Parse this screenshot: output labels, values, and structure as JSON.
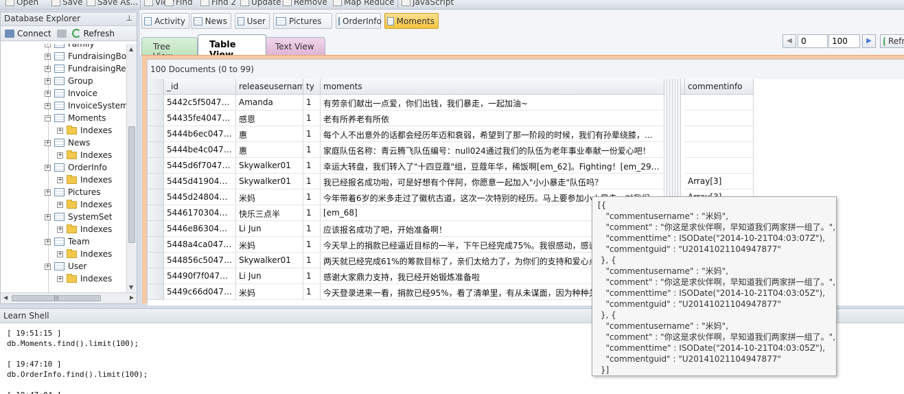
{
  "toolbar": {
    "items": [
      "Open",
      "Save",
      "Save As...",
      "View",
      "Find",
      "Find 2",
      "Update",
      "Remove",
      "Map Reduce",
      "JavaScript"
    ]
  },
  "explorer": {
    "title": "Database Explorer",
    "pin_glyph": "⊥",
    "connect_label": "Connect",
    "refresh_label": "Refresh",
    "tree": [
      {
        "label": "Family",
        "type": "collection"
      },
      {
        "label": "FundraisingBox",
        "type": "collection"
      },
      {
        "label": "FundraisingRec",
        "type": "collection"
      },
      {
        "label": "Group",
        "type": "collection"
      },
      {
        "label": "Invoice",
        "type": "collection"
      },
      {
        "label": "InvoiceSystemS",
        "type": "collection"
      },
      {
        "label": "Moments",
        "type": "collection"
      },
      {
        "label": "Indexes",
        "type": "indexes"
      },
      {
        "label": "News",
        "type": "collection"
      },
      {
        "label": "Indexes",
        "type": "indexes"
      },
      {
        "label": "OrderInfo",
        "type": "collection"
      },
      {
        "label": "Indexes",
        "type": "indexes"
      },
      {
        "label": "Pictures",
        "type": "collection"
      },
      {
        "label": "Indexes",
        "type": "indexes"
      },
      {
        "label": "SystemSet",
        "type": "collection"
      },
      {
        "label": "Indexes",
        "type": "indexes"
      },
      {
        "label": "Team",
        "type": "collection"
      },
      {
        "label": "Indexes",
        "type": "indexes"
      },
      {
        "label": "User",
        "type": "collection"
      },
      {
        "label": "Indexes",
        "type": "indexes"
      }
    ]
  },
  "collections": {
    "tabs": [
      "Activity",
      "News",
      "User",
      "Pictures",
      "OrderInfo",
      "Moments"
    ],
    "active": "Moments"
  },
  "views": {
    "tree": "Tree View",
    "table": "Table View",
    "text": "Text View"
  },
  "pager": {
    "skip": "0",
    "limit": "100",
    "refresh_label": "Refresh"
  },
  "result": {
    "doc_count": "100 Documents (0 to 99)",
    "columns": [
      "_id",
      "releaseusername",
      "ty",
      "moments",
      "commentinfo"
    ],
    "rows": [
      [
        "5442c5f5047ef...",
        "Amanda",
        "1",
        "有劳亲们献出一点爱，你们出钱，我们暴走，一起加油~",
        ""
      ],
      [
        "54435fe4047ef...",
        "感恩",
        "1",
        "老有所养老有所依",
        ""
      ],
      [
        "5444b6ec047ef...",
        "惠",
        "1",
        "每个人不出意外的话都会经历年迈和衰弱，希望到了那一阶段的时候，我们有孙辈绕膝，...",
        ""
      ],
      [
        "5444be4c047ef...",
        "惠",
        "1",
        "家庭队伍名称：青云腾飞队伍编号：null024通过我们的队伍为老年事业奉献一份爱心吧！",
        ""
      ],
      [
        "5445d6f7047ef...",
        "Skywalker01",
        "1",
        "幸运大转盘，我们转入了\"十四豆蔻\"组，豆蔻年华，稀饭啊[em_62]。Fighting！[em_29]亲...",
        ""
      ],
      [
        "5445d419047ef...",
        "Skywalker01",
        "1",
        "我已经报名成功啦，可是好想有个伴阿，你愿意一起加入\"小小暴走\"队伍吗？",
        "Array[3]"
      ],
      [
        "5445d248047ef...",
        "米妈",
        "1",
        "今年带着6岁的米多走过了徽杭古道，这次一次特别的经历。马上要参加小小暴走，对我们...",
        "Array[3]"
      ],
      [
        "54461703047ef...",
        "快乐三点半",
        "1",
        "[em_68]",
        ""
      ],
      [
        "5446e863047ef...",
        "Li Jun",
        "1",
        "应该报名成功了吧，开始准备啊！",
        ""
      ],
      [
        "5448a4ca047e1...",
        "米妈",
        "1",
        "今天早上的捐款已经逼近目标的一半，下午已经完成75%。我很感动，感谢所有...",
        ""
      ],
      [
        "544856c5047e1...",
        "Skywalker01",
        "1",
        "两天就已经完成61%的筹款目标了，亲们太给力了，为你们的支持和爱心点个赞！",
        ""
      ],
      [
        "54490f7f047e1...",
        "Li Jun",
        "1",
        "感谢大家鼎力支持，我已经开始锻炼准备啦",
        ""
      ],
      [
        "5449c66d047e1...",
        "米妈",
        "1",
        "今天登录进来一看，捐款已经95%，看了清单里，有从未谋面，因为种种关系...",
        ""
      ]
    ]
  },
  "tooltip": {
    "content": "[{\n   \"commentusername\" : \"米妈\",\n   \"comment\" : \"你这是求伙伴啊，早知道我们两家拼一组了。\",\n   \"commenttime\" : ISODate(\"2014-10-21T04:03:07Z\"),\n   \"commentguid\" : \"U20141021104947877\"\n }, {\n   \"commentusername\" : \"米妈\",\n   \"comment\" : \"你这是求伙伴啊，早知道我们两家拼一组了。\",\n   \"commenttime\" : ISODate(\"2014-10-21T04:03:05Z\"),\n   \"commentguid\" : \"U20141021104947877\"\n }, {\n   \"commentusername\" : \"米妈\",\n   \"comment\" : \"你这是求伙伴啊，早知道我们两家拼一组了。\",\n   \"commenttime\" : ISODate(\"2014-10-21T04:03:05Z\"),\n   \"commentguid\" : \"U20141021104947877\"\n }]"
  },
  "shell": {
    "title": "Learn Shell",
    "log": "[ 19:51:15 ]\ndb.Moments.find().limit(100);\n\n[ 19:47:10 ]\ndb.OrderInfo.find().limit(100);\n\n[ 19:47:04 ]"
  },
  "colors": {
    "active_tab": "#f3c440",
    "result_frame": "#f6c9a3",
    "tree_view_tab": "#bfe3bf",
    "text_view_tab": "#dfb5d6"
  }
}
